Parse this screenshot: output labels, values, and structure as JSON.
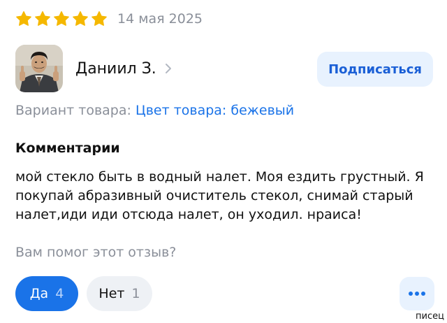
{
  "review": {
    "rating": 5,
    "rating_max": 5,
    "date": "14 мая 2025",
    "colors": {
      "star": "#f5b800",
      "accent": "#1a73e8",
      "muted": "#8a8f99"
    }
  },
  "author": {
    "name": "Даниил З.",
    "avatar_icon": "user-photo",
    "chevron_icon": "chevron-right-icon"
  },
  "subscribe": {
    "label": "Подписаться"
  },
  "variant": {
    "label": "Вариант товара:",
    "value": "Цвет товара: бежевый"
  },
  "comments": {
    "heading": "Комментарии",
    "text": "мой стекло быть в водный налет. Моя ездить грустный. Я покупай абразивный очиститель стекол, снимай старый налет,иди иди отсюда налет, он уходил.  нраиса!"
  },
  "helpful": {
    "question": "Вам помог этот отзыв?",
    "yes_label": "Да",
    "yes_count": "4",
    "no_label": "Нет",
    "no_count": "1",
    "more_icon": "more-dots-icon"
  },
  "watermark": "писец"
}
